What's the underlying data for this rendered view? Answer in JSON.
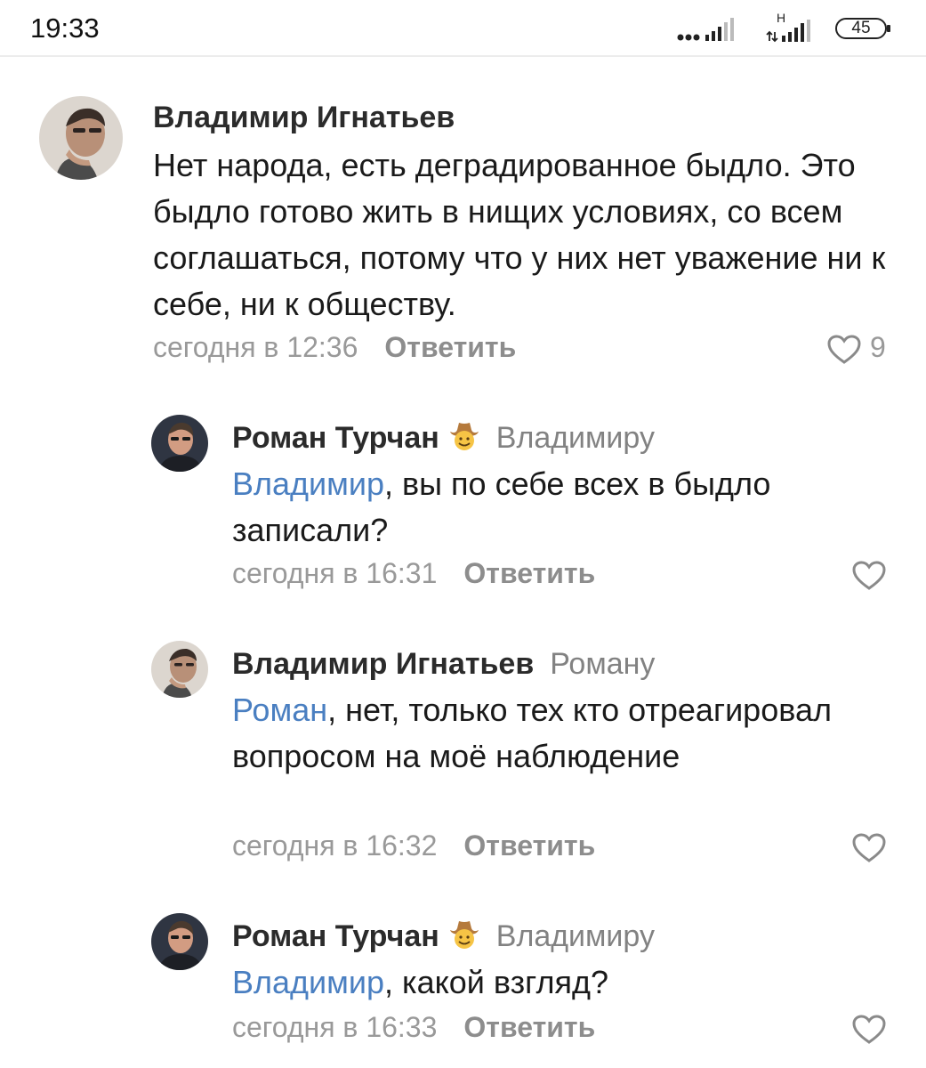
{
  "status_bar": {
    "time": "19:33",
    "network_label": "H",
    "battery_level": "45"
  },
  "comments": [
    {
      "author": "Владимир Игнатьев",
      "text": "Нет народа, есть деградированное быдло. Это быдло готово жить в нищих условиях, со всем соглашаться, потому что у них нет уважение ни к себе, ни к обществу.",
      "time": "сегодня в 12:36",
      "reply_label": "Ответить",
      "likes": "9"
    },
    {
      "author": "Роман Турчан",
      "author_emoji": "cowboy-emoji",
      "reply_to": "Владимиру",
      "mention": "Владимир",
      "text": ", вы по себе всех в быдло записали?",
      "time": "сегодня в 16:31",
      "reply_label": "Ответить"
    },
    {
      "author": "Владимир Игнатьев",
      "reply_to": "Роману",
      "mention": "Роман",
      "text": ", нет, только тех кто отреагировал вопросом на моё наблюдение",
      "time": "сегодня в 16:32",
      "reply_label": "Ответить"
    },
    {
      "author": "Роман Турчан",
      "author_emoji": "cowboy-emoji",
      "reply_to": "Владимиру",
      "mention": "Владимир",
      "text": ", какой взгляд?",
      "time": "сегодня в 16:33",
      "reply_label": "Ответить"
    }
  ],
  "colors": {
    "mention": "#4a7fc1",
    "meta": "#999999",
    "author": "#2b2b2b"
  }
}
